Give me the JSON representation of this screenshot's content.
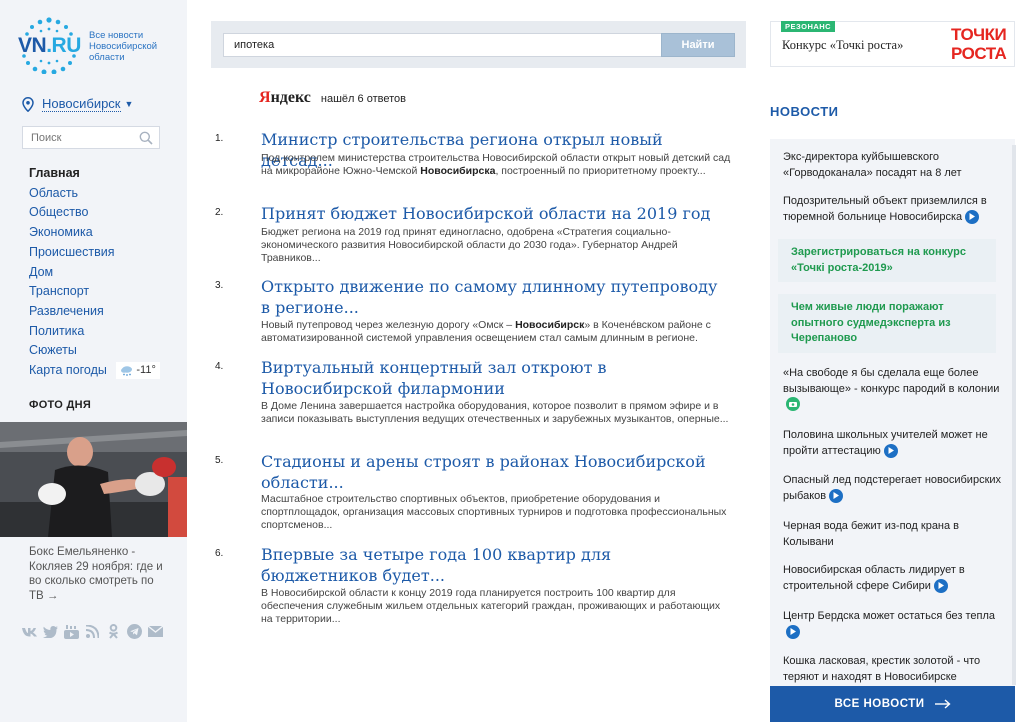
{
  "logo": {
    "name": "VN",
    "domain": ".RU",
    "tagline": "Все новости Новосибирской области"
  },
  "city": {
    "name": "Новосибирск"
  },
  "sidebar_search": {
    "placeholder": "Поиск"
  },
  "nav": {
    "items": [
      "Главная",
      "Область",
      "Общество",
      "Экономика",
      "Происшествия",
      "Дом",
      "Транспорт",
      "Развлечения",
      "Политика",
      "Сюжеты",
      "Карта погоды"
    ],
    "weather": "-11°"
  },
  "photo_of_day": {
    "title": "ФОТО ДНЯ",
    "caption": "Бокс Емельяненко - Кокляев 29 ноября: где и во сколько смотреть по ТВ",
    "arrow": "→"
  },
  "social": {
    "icons": [
      "vk-icon",
      "twitter-icon",
      "youtube-icon",
      "rss-icon",
      "odnoklassniki-icon",
      "telegram-icon",
      "mail-icon"
    ]
  },
  "search": {
    "query": "ипотека",
    "button": "Найти",
    "engine_prefix": "Я",
    "engine_rest": "ндекс",
    "found_text": "нашёл 6 ответов"
  },
  "results": [
    {
      "num": "1.",
      "title": "Министр строительства региона открыл новый детсад...",
      "snippet_before": "Под контролем министерства строительства Новосибирской области открыт новый детский сад на микрорайоне Южно-Чемской ",
      "snippet_bold": "Новосибирска",
      "snippet_after": ", построенный по приоритетному проекту..."
    },
    {
      "num": "2.",
      "title": "Принят бюджет Новосибирской области на 2019 год",
      "snippet_before": "Бюджет региона на 2019 год принят единогласно, одобрена «Стратегия социально-экономического развития Новосибирской области до 2030 года». Губернатор Андрей Травников...",
      "snippet_bold": "",
      "snippet_after": ""
    },
    {
      "num": "3.",
      "title": "Открыто движение по самому длинному путепроводу в регионе...",
      "snippet_before": "Новый путепровод через железную дорогу «Омск – ",
      "snippet_bold": "Новосибирск",
      "snippet_after": "» в Кочене́вском районе с автоматизированной системой управления освещением стал самым длинным в регионе."
    },
    {
      "num": "4.",
      "title": "Виртуальный концертный зал откроют в Новосибирской филармонии",
      "snippet_before": "В Доме Ленина завершается настройка оборудования, которое позволит в прямом эфире и в записи показывать выступления ведущих отечественных и зарубежных музыкантов, оперные...",
      "snippet_bold": "",
      "snippet_after": ""
    },
    {
      "num": "5.",
      "title": "Стадионы и арены строят в районах Новосибирской области...",
      "snippet_before": "Масштабное строительство спортивных объектов, приобретение оборудования и спортплощадок, организация массовых спортивных турниров и подготовка профессиональных спортсменов...",
      "snippet_bold": "",
      "snippet_after": ""
    },
    {
      "num": "6.",
      "title": "Впервые за четыре года 100 квартир для бюджетников будет...",
      "snippet_before": "В Новосибирской области к концу 2019 года планируется построить 100 квартир для обеспечения служебным жильем отдельных категорий граждан, проживающих и работающих на территории...",
      "snippet_bold": "",
      "snippet_after": ""
    }
  ],
  "promo": {
    "badge": "РЕЗОНАНС",
    "text": "Конкурс «Точкi роста»",
    "logo_line1": "ТОЧКИ",
    "logo_line2": "РОСТА"
  },
  "news": {
    "heading": "НОВОСТИ",
    "items": [
      {
        "text": "Экс-директора куйбышевского «Горводоканала» посадят на 8 лет",
        "icon": ""
      },
      {
        "text": "Подозрительный объект приземлился в тюремной больнице Новосибирска",
        "icon": "play"
      },
      {
        "text": "Зарегистрироваться на конкурс «Точкі роста-2019»",
        "icon": "",
        "promo": true
      },
      {
        "text": "Чем живые люди поражают опытного судмедэксперта из Черепаново",
        "icon": "",
        "promo": true
      },
      {
        "text": "«На свободе я бы сделала еще более вызывающе» - конкурс пародий в колонии",
        "icon": "camera"
      },
      {
        "text": "Половина школьных учителей может не пройти аттестацию",
        "icon": "play"
      },
      {
        "text": "Опасный лед подстерегает новосибирских рыбаков",
        "icon": "play"
      },
      {
        "text": "Черная вода бежит из-под крана в Колывани",
        "icon": ""
      },
      {
        "text": "Новосибирская область лидирует в строительной сфере Сибири",
        "icon": "play"
      },
      {
        "text": "Центр Бердска может остаться без тепла",
        "icon": "play"
      },
      {
        "text": "Кошка ласковая, крестик золотой - что теряют и находят в Новосибирске",
        "icon": ""
      }
    ],
    "all_news": "ВСЕ НОВОСТИ"
  },
  "colors": {
    "brand_blue": "#1d5aa8",
    "accent_green": "#2bb673",
    "promo_red": "#e52620"
  }
}
